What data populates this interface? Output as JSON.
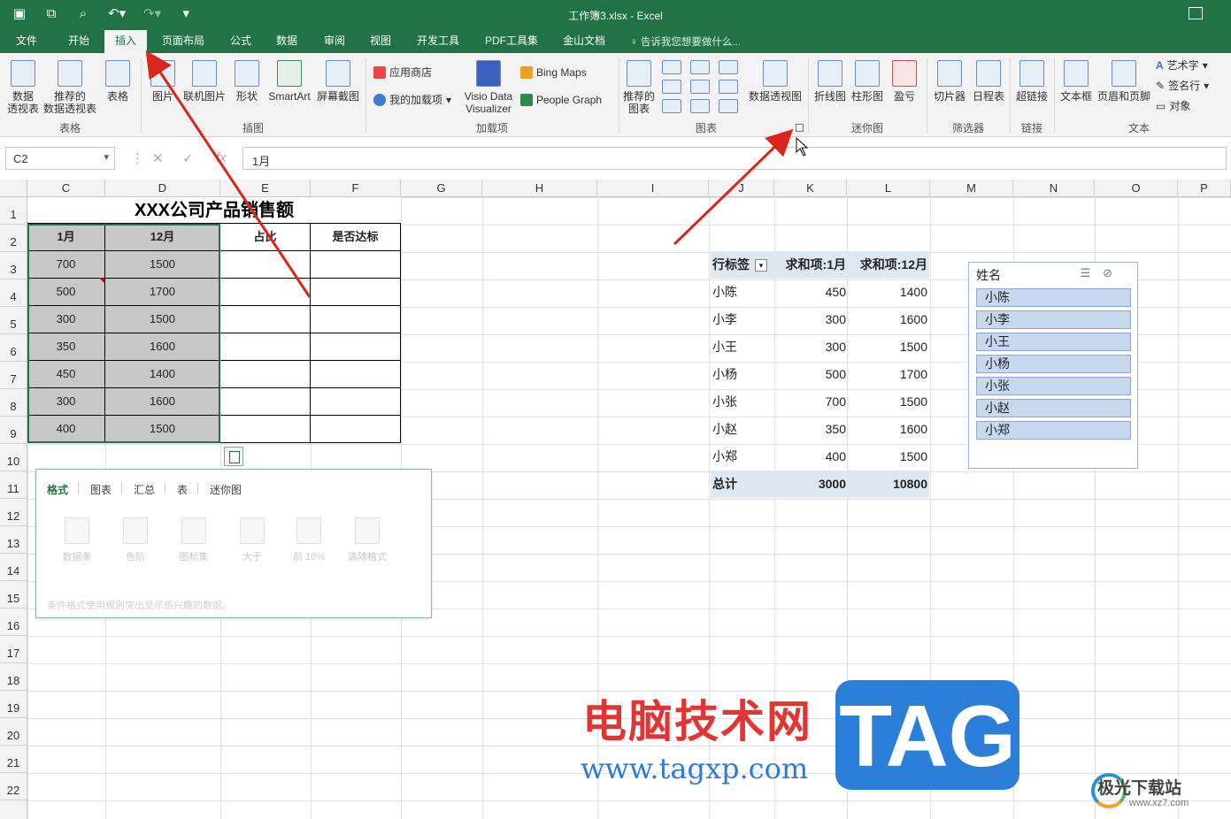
{
  "title_bar": {
    "doc_title": "工作簿3.xlsx - Excel",
    "qat": [
      "save-icon",
      "save-as-icon",
      "print-preview-icon",
      "undo-icon",
      "redo-icon",
      "customize-icon"
    ]
  },
  "menu": {
    "tabs": [
      "文件",
      "开始",
      "插入",
      "页面布局",
      "公式",
      "数据",
      "审阅",
      "视图",
      "开发工具",
      "PDF工具集",
      "金山文档"
    ],
    "active": "插入",
    "tell_me": "告诉我您想要做什么..."
  },
  "ribbon": {
    "groups": {
      "tables": "表格",
      "illustrations": "插图",
      "addins": "加载项",
      "charts": "图表",
      "sparklines": "迷你图",
      "filters": "筛选器",
      "links": "链接",
      "text": "文本"
    },
    "buttons": {
      "pivot_table": "数据\n透视表",
      "recommended_pivot": "推荐的\n数据透视表",
      "table": "表格",
      "pictures": "图片",
      "online_pictures": "联机图片",
      "shapes": "形状",
      "smartart": "SmartArt",
      "screenshot": "屏幕截图",
      "store": "应用商店",
      "my_addins": "我的加载项",
      "visio": "Visio Data\nVisualizer",
      "bing_maps": "Bing Maps",
      "people_graph": "People Graph",
      "recommended_charts": "推荐的\n图表",
      "pivot_chart": "数据透视图",
      "line_spark": "折线图",
      "column_spark": "柱形图",
      "winloss_spark": "盈亏",
      "slicer": "切片器",
      "timeline": "日程表",
      "hyperlink": "超链接",
      "textbox": "文本框",
      "header_footer": "页眉和页脚",
      "wordart": "艺术字",
      "signature": "签名行",
      "object": "对象"
    }
  },
  "formula_bar": {
    "name_box": "C2",
    "formula": "1月"
  },
  "columns": [
    "C",
    "D",
    "E",
    "F",
    "G",
    "H",
    "I",
    "J",
    "K",
    "L",
    "M",
    "N",
    "O",
    "P"
  ],
  "rows": [
    "1",
    "2",
    "3",
    "4",
    "5",
    "6",
    "7",
    "8",
    "9",
    "10",
    "11",
    "12",
    "13",
    "14",
    "15",
    "16",
    "17",
    "18",
    "19",
    "20",
    "21",
    "22"
  ],
  "sheet": {
    "title": "XXX公司产品销售额",
    "headers": [
      "1月",
      "12月",
      "占比",
      "是否达标"
    ],
    "data": [
      [
        "700",
        "1500"
      ],
      [
        "500",
        "1700"
      ],
      [
        "300",
        "1500"
      ],
      [
        "350",
        "1600"
      ],
      [
        "450",
        "1400"
      ],
      [
        "300",
        "1600"
      ],
      [
        "400",
        "1500"
      ]
    ]
  },
  "quick_analysis": {
    "tabs": [
      "格式",
      "图表",
      "汇总",
      "表",
      "迷你图"
    ],
    "items": [
      "数据条",
      "色阶",
      "图标集",
      "大于",
      "前 10%",
      "清除格式"
    ],
    "description": "条件格式使用规则突出显示感兴趣的数据。"
  },
  "pivot": {
    "headers": [
      "行标签",
      "求和项:1月",
      "求和项:12月"
    ],
    "rows": [
      [
        "小陈",
        "450",
        "1400"
      ],
      [
        "小李",
        "300",
        "1600"
      ],
      [
        "小王",
        "300",
        "1500"
      ],
      [
        "小杨",
        "500",
        "1700"
      ],
      [
        "小张",
        "700",
        "1500"
      ],
      [
        "小赵",
        "350",
        "1600"
      ],
      [
        "小郑",
        "400",
        "1500"
      ]
    ],
    "total": [
      "总计",
      "3000",
      "10800"
    ]
  },
  "slicer": {
    "title": "姓名",
    "items": [
      "小陈",
      "小李",
      "小王",
      "小杨",
      "小张",
      "小赵",
      "小郑"
    ]
  },
  "watermark": {
    "text": "电脑技术网",
    "url": "www.tagxp.com",
    "tag": "TAG",
    "logo": "极光下载站",
    "logo_url": "www.xz7.com"
  },
  "colors": {
    "accent": "#217346",
    "annotation": "#d9251c",
    "selection": "#c7c7c7",
    "pivot_header": "#dde8f3",
    "slicer_item": "#c6d9ef"
  }
}
